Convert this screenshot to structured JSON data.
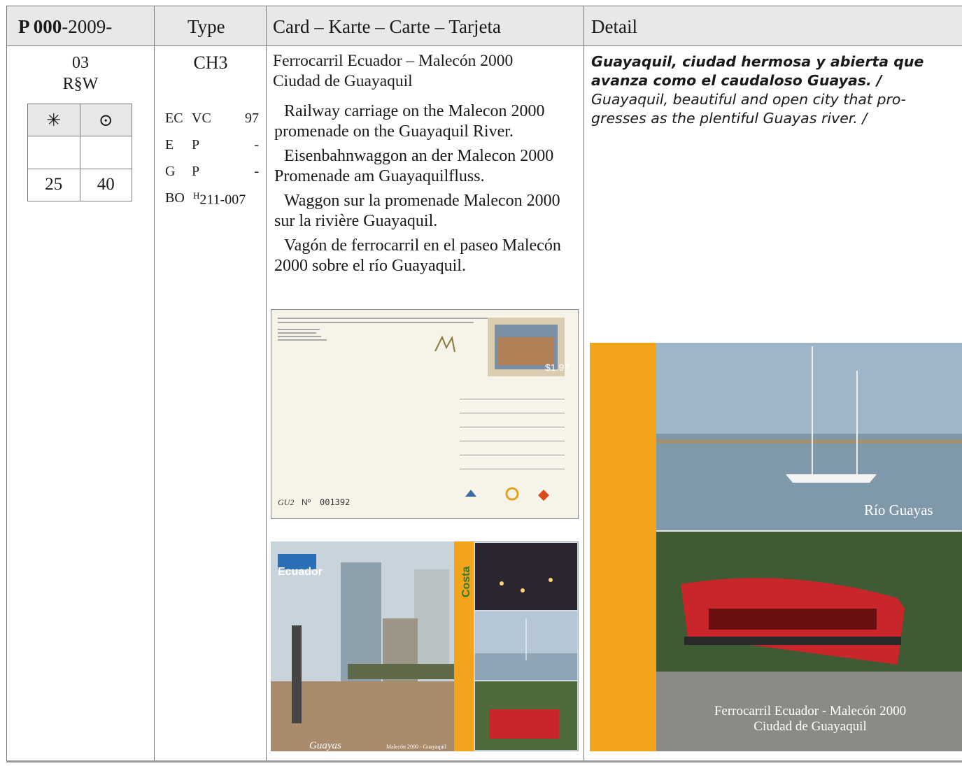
{
  "header": {
    "catalog_bold": "P 000",
    "catalog_rest": "-2009-",
    "type": "Type",
    "card": "Card – Karte – Carte – Tarjeta",
    "detail": "Detail"
  },
  "entry": {
    "number": "03",
    "code": "R§W",
    "stamp_table": {
      "col1_icon": "asterisk-icon",
      "col2_icon": "circled-dot-icon",
      "col1_value": "25",
      "col2_value": "40"
    },
    "type": {
      "code": "CH3",
      "rows": [
        {
          "k1": "EC",
          "k2": "VC",
          "k3": "97"
        },
        {
          "k1": "E",
          "k2": "P",
          "k3": "-"
        },
        {
          "k1": "G",
          "k2": "P",
          "k3": "-"
        },
        {
          "k1": "BO",
          "k2": "H211-007",
          "k3": ""
        }
      ],
      "bo_superscript": "H",
      "bo_code": "211-007"
    },
    "card": {
      "title_line1": "Ferrocarril Ecuador – Malecón 2000",
      "title_line2": "Ciudad de Guayaquil",
      "translations": [
        "Railway carriage on the Malecon 2000 promenade on the Guayaquil River.",
        "Eisenbahnwaggon an der Malecon 2000 Promenade am Guayaquilfluss.",
        "Waggon sur la promenade Malecon 2000 sur la rivière Guayaquil.",
        "Vagón de ferrocarril en el paseo Malecón 2000 sobre el río Guayaquil."
      ],
      "postcard_back": {
        "serial_prefix": "GU2",
        "serial_no": "Nº",
        "serial": "001392",
        "stamp_value": "$1.97"
      },
      "postcard_front": {
        "brand": "Ecuador",
        "side_label": "Costa",
        "caption_left": "Guayas",
        "caption_mid": "Malecón 2000 - Guayaquil"
      }
    },
    "detail": {
      "es_line1": "Guayaquil, ciudad hermosa y abierta que",
      "es_line2": "avanza como el caudaloso Guayas. /",
      "en_line1": "Guayaquil, beautiful and open city that pro-",
      "en_line2": "gresses as the plentiful Guayas river. /",
      "image_caption_top": "Río Guayas",
      "image_caption_bottom1": "Ferrocarril Ecuador - Malecón 2000",
      "image_caption_bottom2": "Ciudad de Guayaquil"
    }
  },
  "colors": {
    "header_bg": "#e8e8e8",
    "rule": "#7a7a7a",
    "orange_band": "#f2a51c",
    "train_red": "#c8262a"
  }
}
